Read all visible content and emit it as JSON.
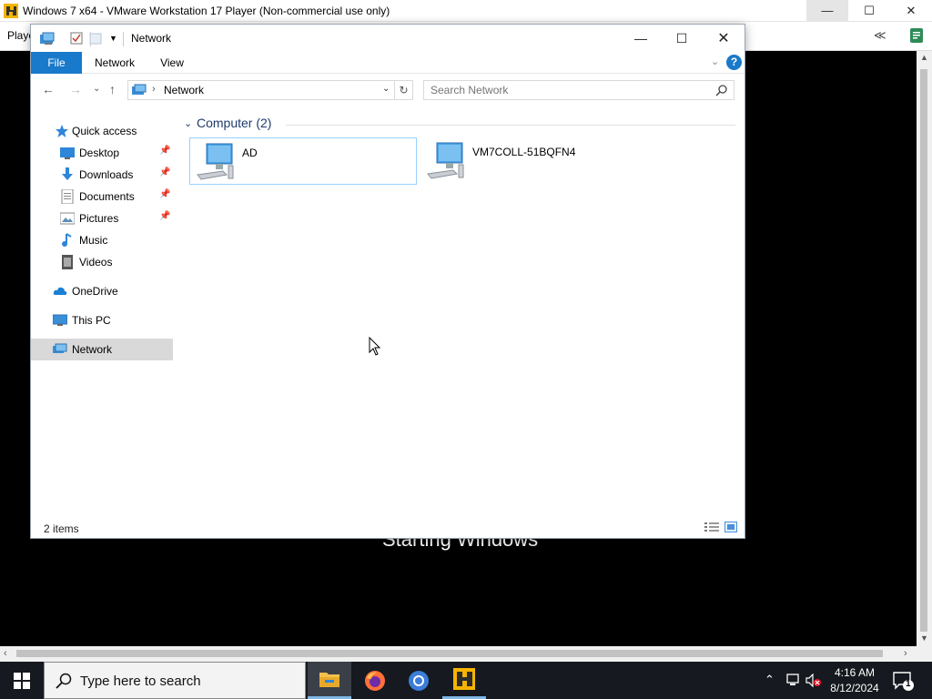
{
  "vmware": {
    "title": "Windows 7 x64 - VMware Workstation 17 Player (Non-commercial use only)",
    "player_menu": "Player",
    "collapse_label": "≪",
    "minimize": "—",
    "maximize": "☐",
    "close": "✕"
  },
  "guest": {
    "starting_text": "Starting Windows"
  },
  "explorer": {
    "title": "Network",
    "ribbon_tabs": [
      "File",
      "Network",
      "View"
    ],
    "help_label": "?",
    "address_crumb": "Network",
    "search_placeholder": "Search Network",
    "nav": [
      {
        "label": "Quick access",
        "icon": "star-icon"
      },
      {
        "label": "Desktop",
        "icon": "desktop-icon",
        "pinned": true
      },
      {
        "label": "Downloads",
        "icon": "download-icon",
        "pinned": true
      },
      {
        "label": "Documents",
        "icon": "documents-icon",
        "pinned": true
      },
      {
        "label": "Pictures",
        "icon": "pictures-icon",
        "pinned": true
      },
      {
        "label": "Music",
        "icon": "music-icon"
      },
      {
        "label": "Videos",
        "icon": "videos-icon"
      },
      {
        "label": "OneDrive",
        "icon": "cloud-icon"
      },
      {
        "label": "This PC",
        "icon": "pc-icon"
      },
      {
        "label": "Network",
        "icon": "network-icon",
        "selected": true
      }
    ],
    "group_header": "Computer (2)",
    "computers": [
      {
        "name": "AD",
        "selected": true
      },
      {
        "name": "VM7COLL-51BQFN4",
        "selected": false
      }
    ],
    "status_count": "2 items"
  },
  "taskbar": {
    "search_placeholder": "Type here to search",
    "time": "4:16 AM",
    "date": "8/12/2024",
    "notification_count": "1"
  },
  "colors": {
    "accent": "#1979ca",
    "selection_border": "#99d1ff",
    "taskbar_bg": "#16191f"
  }
}
